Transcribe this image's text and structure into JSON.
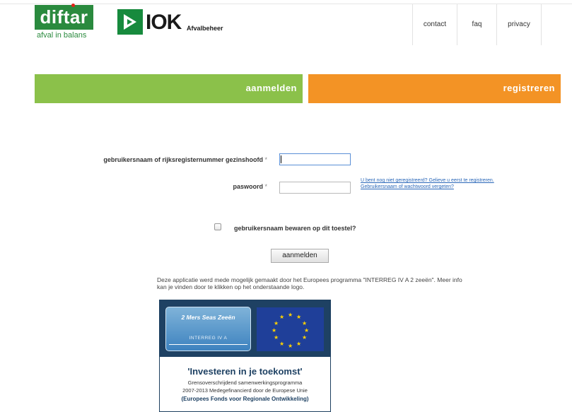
{
  "header": {
    "diftar": {
      "name": "diftar",
      "tagline": "afval in balans",
      "color": "#2a8a3e"
    },
    "iok": {
      "name": "IOK",
      "subtitle": "Afvalbeheer"
    },
    "nav": [
      {
        "label": "contact"
      },
      {
        "label": "faq"
      },
      {
        "label": "privacy"
      }
    ]
  },
  "tabs": {
    "login": {
      "label": "aanmelden",
      "color": "#8bc14a"
    },
    "register": {
      "label": "registreren",
      "color": "#f39325"
    }
  },
  "form": {
    "username_label": "gebruikersnaam of rijksregisternummer gezinshoofd",
    "password_label": "paswoord",
    "required_mark": "*",
    "username_value": "",
    "password_value": "",
    "help_links": [
      "U bent nog niet geregistreerd? Gelieve u eerst te registreren.",
      "Gebruikersnaam of wachtwoord vergeten?"
    ],
    "remember_label": "gebruikersnaam bewaren op dit toestel?",
    "submit_label": "aanmelden"
  },
  "info": {
    "text": "Deze applicatie werd mede mogelijk gemaakt door het Europees programma \"INTERREG IV A 2 zeeën\". Meer info kan je vinden door te klikken op het onderstaande logo."
  },
  "banner": {
    "seas_title": "2 Mers Seas Zeeën",
    "seas_sub": "INTERREG IV A",
    "headline": "'Investeren in je toekomst'",
    "line1": "Grensoverschrijdend samenwerkingsprogramma",
    "line2": "2007-2013 Medegefinancierd door de Europese Unie",
    "line3": "(Europees Fonds voor Regionale Ontwikkeling)"
  }
}
